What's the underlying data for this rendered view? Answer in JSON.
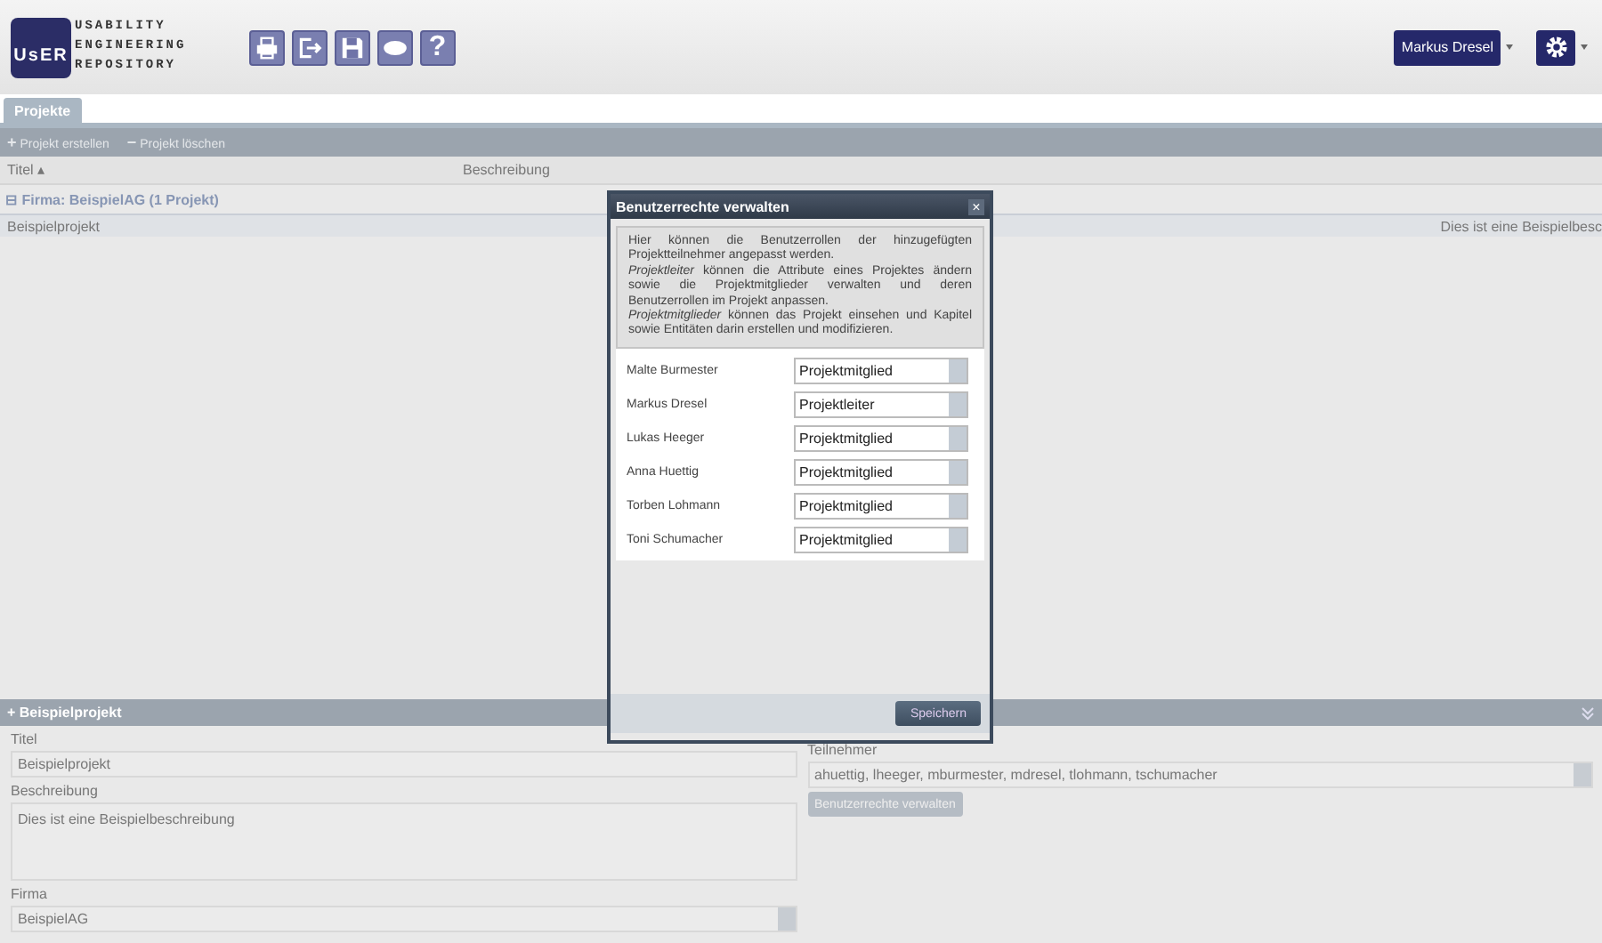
{
  "logo": {
    "mark": "UsER",
    "lines": [
      "USABILITY",
      "ENGINEERING",
      "REPOSITORY"
    ]
  },
  "toolbar_icons": [
    {
      "kind": "print"
    },
    {
      "kind": "exit"
    },
    {
      "kind": "save"
    },
    {
      "kind": "chat"
    },
    {
      "kind": "help",
      "label": "?"
    }
  ],
  "user_button": "Markus Dresel",
  "tabs": [
    {
      "label": "Projekte",
      "selected": true
    }
  ],
  "actions": [
    {
      "icon": "+",
      "label": "Projekt erstellen"
    },
    {
      "icon": "−",
      "label": "Projekt löschen"
    }
  ],
  "table": {
    "columns": [
      "Titel ▴",
      "Beschreibung"
    ],
    "group": {
      "icon": "⊟",
      "label": "Firma: BeispielAG (1 Projekt)"
    },
    "rows": [
      {
        "cells": [
          "Beispielprojekt",
          "Dies ist eine Beispielbesc"
        ],
        "selected": true
      }
    ]
  },
  "detail": {
    "title": "Beispielprojekt",
    "icon": "+",
    "fields": [
      {
        "label": "Titel",
        "value": "Beispielprojekt",
        "kind": "text"
      },
      {
        "label": "Beschreibung",
        "value": "Dies ist eine Beispielbeschreibung",
        "kind": "textarea"
      },
      {
        "label": "Firma",
        "value": "BeispielAG",
        "kind": "select"
      }
    ],
    "participants": {
      "label": "Teilnehmer",
      "value": "ahuettig, lheeger, mburmester, mdresel, tlohmann, tschumacher"
    },
    "rights_button": "Benutzerrechte verwalten"
  },
  "dialog": {
    "title": "Benutzerrechte verwalten",
    "close": "×",
    "info": [
      "Hier können die Benutzerrollen der hinzugefügten Projektteilnehmer angepasst werden.",
      "*Projektleiter* können die Attribute eines Projektes ändern sowie die Projektmitglieder verwalten und deren Benutzerrollen im Projekt anpassen.",
      "*Projektmitglieder* können das Projekt einsehen und Kapitel sowie Entitäten darin erstellen und modifizieren."
    ],
    "users": [
      {
        "name": "Malte Burmester",
        "role": "Projektmitglied"
      },
      {
        "name": "Markus Dresel",
        "role": "Projektleiter"
      },
      {
        "name": "Lukas Heeger",
        "role": "Projektmitglied"
      },
      {
        "name": "Anna Huettig",
        "role": "Projektmitglied"
      },
      {
        "name": "Torben Lohmann",
        "role": "Projektmitglied"
      },
      {
        "name": "Toni Schumacher",
        "role": "Projektmitglied"
      }
    ],
    "save_button": "Speichern"
  }
}
